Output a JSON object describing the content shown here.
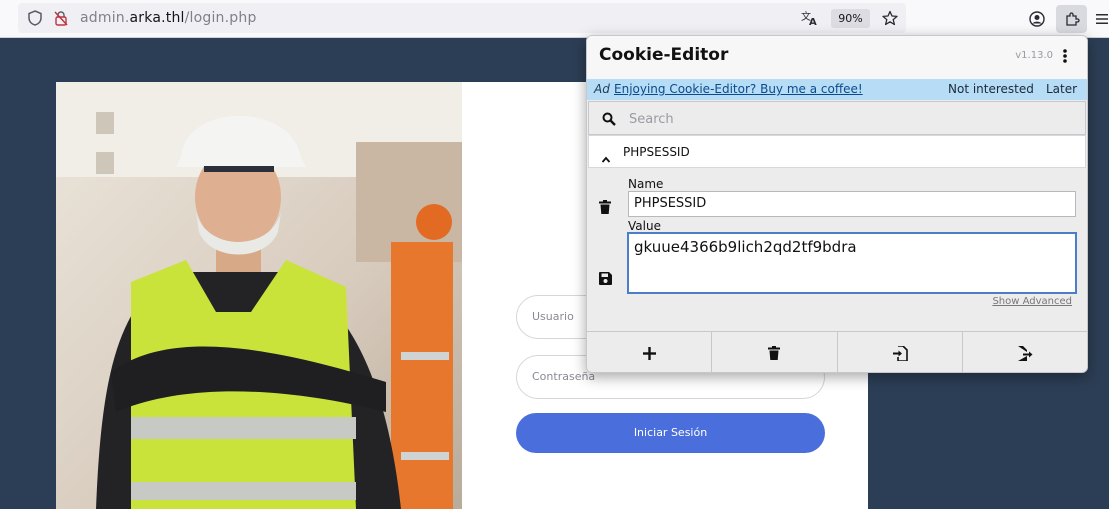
{
  "browser": {
    "url_prefix": "admin.",
    "url_domain": "arka.thl",
    "url_path": "/login.php",
    "zoom": "90%"
  },
  "login": {
    "username_placeholder": "Usuario",
    "password_placeholder": "Contraseña",
    "submit_label": "Iniciar Sesión"
  },
  "cookie_editor": {
    "title": "Cookie-Editor",
    "version": "v1.13.0",
    "ad": {
      "label": "Ad",
      "link": "Enjoying Cookie-Editor? Buy me a coffee!",
      "not_interested": "Not interested",
      "later": "Later"
    },
    "search_placeholder": "Search",
    "cookie": {
      "header": "PHPSESSID",
      "name_label": "Name",
      "name_value": "PHPSESSID",
      "value_label": "Value",
      "value_value": "gkuue4366b9lich2qd2tf9bdra"
    },
    "show_advanced": "Show Advanced"
  }
}
